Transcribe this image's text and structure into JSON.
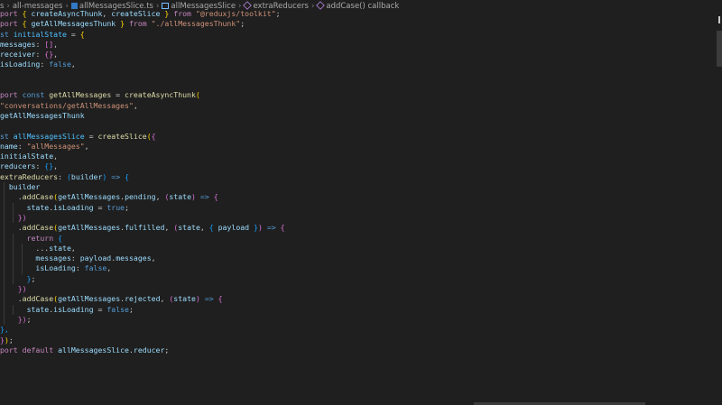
{
  "breadcrumb": [
    {
      "label": "s",
      "icon": "none"
    },
    {
      "label": "all-messages",
      "icon": "none"
    },
    {
      "label": "allMessagesSlice.ts",
      "icon": "typescript-file-icon",
      "icon_color": "#3178c6"
    },
    {
      "label": "allMessagesSlice",
      "icon": "variable-icon",
      "icon_color": "#75beff"
    },
    {
      "label": "extraReducers",
      "icon": "method-icon",
      "icon_color": "#b180d7"
    },
    {
      "label": "addCase() callback",
      "icon": "function-icon",
      "icon_color": "#b180d7"
    }
  ],
  "code_lines": [
    [
      [
        "kw",
        "port "
      ],
      [
        "p1",
        "{ "
      ],
      [
        "var",
        "createAsyncThunk"
      ],
      [
        "txt",
        ", "
      ],
      [
        "var",
        "createSlice"
      ],
      [
        "p1",
        " }"
      ],
      [
        "kw",
        " from "
      ],
      [
        "str",
        "\"@reduxjs/toolkit\""
      ],
      [
        "txt",
        ";"
      ]
    ],
    [
      [
        "kw",
        "port "
      ],
      [
        "p1",
        "{ "
      ],
      [
        "var",
        "getAllMessagesThunk"
      ],
      [
        "p1",
        " }"
      ],
      [
        "kw",
        " from "
      ],
      [
        "str",
        "\"./allMessagesThunk\""
      ],
      [
        "txt",
        ";"
      ]
    ],
    [
      [
        "kb",
        "st "
      ],
      [
        "cst",
        "initialState"
      ],
      [
        "txt",
        " = "
      ],
      [
        "p1",
        "{"
      ]
    ],
    [
      [
        "var",
        "messages"
      ],
      [
        "txt",
        ": "
      ],
      [
        "p2",
        "[]"
      ],
      [
        "txt",
        ","
      ]
    ],
    [
      [
        "var",
        "receiver"
      ],
      [
        "txt",
        ": "
      ],
      [
        "p2",
        "{}"
      ],
      [
        "txt",
        ","
      ]
    ],
    [
      [
        "var",
        "isLoading"
      ],
      [
        "txt",
        ": "
      ],
      [
        "kb",
        "false"
      ],
      [
        "txt",
        ","
      ]
    ],
    [],
    [],
    [
      [
        "kw",
        "port "
      ],
      [
        "kb",
        "const "
      ],
      [
        "fn",
        "getAllMessages"
      ],
      [
        "txt",
        " = "
      ],
      [
        "fn",
        "createAsyncThunk"
      ],
      [
        "p1",
        "("
      ]
    ],
    [
      [
        "str",
        "\"conversations/getAllMessages\""
      ],
      [
        "txt",
        ","
      ]
    ],
    [
      [
        "var",
        "getAllMessagesThunk"
      ]
    ],
    [],
    [
      [
        "kb",
        "st "
      ],
      [
        "cst",
        "allMessagesSlice"
      ],
      [
        "txt",
        " = "
      ],
      [
        "fn",
        "createSlice"
      ],
      [
        "p1",
        "("
      ],
      [
        "p2",
        "{"
      ]
    ],
    [
      [
        "var",
        "name"
      ],
      [
        "txt",
        ": "
      ],
      [
        "str",
        "\"allMessages\""
      ],
      [
        "txt",
        ","
      ]
    ],
    [
      [
        "var",
        "initialState"
      ],
      [
        "txt",
        ","
      ]
    ],
    [
      [
        "var",
        "reducers"
      ],
      [
        "txt",
        ": "
      ],
      [
        "p3",
        "{}"
      ],
      [
        "txt",
        ","
      ]
    ],
    [
      [
        "fn",
        "extraReducers"
      ],
      [
        "txt",
        ": "
      ],
      [
        "p3",
        "("
      ],
      [
        "var",
        "builder"
      ],
      [
        "p3",
        ")"
      ],
      [
        "kb",
        " => "
      ],
      [
        "p3",
        "{"
      ]
    ],
    [
      [
        "var",
        "  builder"
      ]
    ],
    [
      [
        "txt",
        "    ."
      ],
      [
        "fn",
        "addCase"
      ],
      [
        "p1",
        "("
      ],
      [
        "var",
        "getAllMessages"
      ],
      [
        "txt",
        "."
      ],
      [
        "var",
        "pending"
      ],
      [
        "txt",
        ", "
      ],
      [
        "p2",
        "("
      ],
      [
        "var",
        "state"
      ],
      [
        "p2",
        ")"
      ],
      [
        "kb",
        " => "
      ],
      [
        "p2",
        "{"
      ]
    ],
    [
      [
        "var",
        "      state"
      ],
      [
        "txt",
        "."
      ],
      [
        "var",
        "isLoading"
      ],
      [
        "txt",
        " = "
      ],
      [
        "kb",
        "true"
      ],
      [
        "txt",
        ";"
      ]
    ],
    [
      [
        "p2",
        "    })"
      ]
    ],
    [
      [
        "txt",
        "    ."
      ],
      [
        "fn",
        "addCase"
      ],
      [
        "p1",
        "("
      ],
      [
        "var",
        "getAllMessages"
      ],
      [
        "txt",
        "."
      ],
      [
        "var",
        "fulfilled"
      ],
      [
        "txt",
        ", "
      ],
      [
        "p2",
        "("
      ],
      [
        "var",
        "state"
      ],
      [
        "txt",
        ", "
      ],
      [
        "p3",
        "{ "
      ],
      [
        "var",
        "payload"
      ],
      [
        "p3",
        " }"
      ],
      [
        "p2",
        ")"
      ],
      [
        "kb",
        " => "
      ],
      [
        "p2",
        "{"
      ]
    ],
    [
      [
        "kw",
        "      return "
      ],
      [
        "p3",
        "{"
      ]
    ],
    [
      [
        "txt",
        "        ..."
      ],
      [
        "var",
        "state"
      ],
      [
        "txt",
        ","
      ]
    ],
    [
      [
        "var",
        "        messages"
      ],
      [
        "txt",
        ": "
      ],
      [
        "var",
        "payload"
      ],
      [
        "txt",
        "."
      ],
      [
        "var",
        "messages"
      ],
      [
        "txt",
        ","
      ]
    ],
    [
      [
        "var",
        "        isLoading"
      ],
      [
        "txt",
        ": "
      ],
      [
        "kb",
        "false"
      ],
      [
        "txt",
        ","
      ]
    ],
    [
      [
        "p3",
        "      }"
      ],
      [
        "txt",
        ";"
      ]
    ],
    [
      [
        "p2",
        "    })"
      ]
    ],
    [
      [
        "txt",
        "    ."
      ],
      [
        "fn",
        "addCase"
      ],
      [
        "p1",
        "("
      ],
      [
        "var",
        "getAllMessages"
      ],
      [
        "txt",
        "."
      ],
      [
        "var",
        "rejected"
      ],
      [
        "txt",
        ", "
      ],
      [
        "p2",
        "("
      ],
      [
        "var",
        "state"
      ],
      [
        "p2",
        ")"
      ],
      [
        "kb",
        " => "
      ],
      [
        "p2",
        "{"
      ]
    ],
    [
      [
        "var",
        "      state"
      ],
      [
        "txt",
        "."
      ],
      [
        "var",
        "isLoading"
      ],
      [
        "txt",
        " = "
      ],
      [
        "kb",
        "false"
      ],
      [
        "txt",
        ";"
      ]
    ],
    [
      [
        "p2",
        "    })"
      ],
      [
        "txt",
        ";"
      ]
    ],
    [
      [
        "p3",
        "},"
      ]
    ],
    [
      [
        "p2",
        "}"
      ],
      [
        "p1",
        ")"
      ],
      [
        "txt",
        ";"
      ]
    ],
    [
      [
        "kw",
        "port default "
      ],
      [
        "var",
        "allMessagesSlice"
      ],
      [
        "txt",
        "."
      ],
      [
        "var",
        "reducer"
      ],
      [
        "txt",
        ";"
      ]
    ]
  ]
}
